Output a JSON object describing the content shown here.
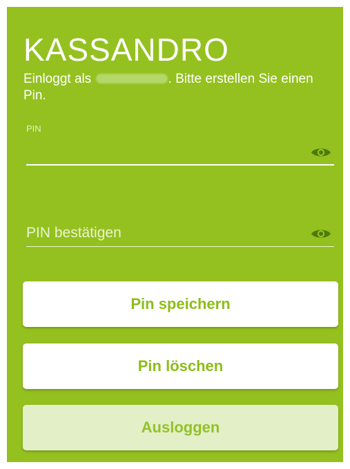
{
  "app": {
    "title": "KASSANDRO",
    "subtitle_prefix": "Einloggt als ",
    "subtitle_suffix": ". Bitte erstellen Sie einen Pin."
  },
  "pin_field": {
    "label": "PIN",
    "value": "",
    "toggle_icon": "eye-icon"
  },
  "confirm_field": {
    "placeholder": "PIN bestätigen",
    "value": "",
    "toggle_icon": "eye-icon"
  },
  "buttons": {
    "save_label": "Pin speichern",
    "delete_label": "Pin löschen",
    "logout_label": "Ausloggen"
  },
  "colors": {
    "background": "#94c11f",
    "accent_text": "#8cbd1a",
    "icon": "#4f7a0c",
    "disabled_button": "#e3efc6"
  }
}
